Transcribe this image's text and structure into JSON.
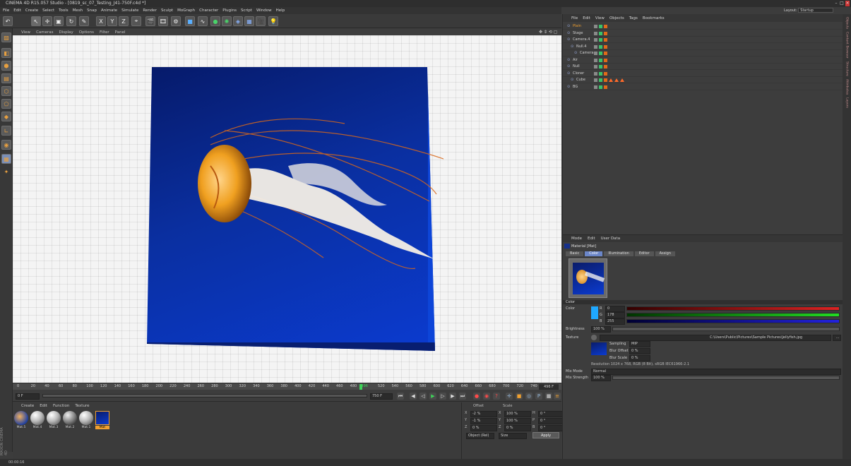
{
  "window": {
    "title": "CINEMA 4D R15.057 Studio - [0819_sc_07_Testing_J41-750F.c4d *]"
  },
  "menu": [
    "File",
    "Edit",
    "Create",
    "Select",
    "Tools",
    "Mesh",
    "Snap",
    "Animate",
    "Simulate",
    "Render",
    "Sculpt",
    "MoGraph",
    "Character",
    "Plugins",
    "Script",
    "Window",
    "Help"
  ],
  "layout": {
    "label": "Layout:",
    "value": "Startup"
  },
  "toolbar": {
    "x": "X",
    "y": "Y",
    "z": "Z"
  },
  "viewport": {
    "menu": [
      "View",
      "Cameras",
      "Display",
      "Options",
      "Filter",
      "Panel"
    ]
  },
  "timeline": {
    "ticks": [
      "0",
      "20",
      "40",
      "60",
      "80",
      "100",
      "120",
      "140",
      "160",
      "180",
      "200",
      "220",
      "240",
      "260",
      "280",
      "300",
      "320",
      "340",
      "360",
      "380",
      "400",
      "420",
      "440",
      "460",
      "480",
      "496",
      "520",
      "540",
      "560",
      "580",
      "600",
      "620",
      "640",
      "660",
      "680",
      "700",
      "720",
      "740"
    ],
    "end_frame": "496 F",
    "current_frame": 496,
    "frame_range": [
      0,
      750
    ]
  },
  "transport": {
    "start": "0 F",
    "end": "750 F"
  },
  "materials": {
    "menu": [
      "Create",
      "Edit",
      "Function",
      "Texture"
    ],
    "items": [
      {
        "name": "Mat.5",
        "selected": false
      },
      {
        "name": "Mat.4",
        "selected": false
      },
      {
        "name": "Mat.3",
        "selected": false
      },
      {
        "name": "Mat.2",
        "selected": false
      },
      {
        "name": "Mat.1",
        "selected": false
      },
      {
        "name": "Mat",
        "selected": true
      }
    ]
  },
  "maxon": "MAXON CINEMA 4D",
  "coords": {
    "headers": [
      "Position",
      "Offset",
      "Scale"
    ],
    "rows": [
      {
        "axis": "X",
        "pos": "-2 %",
        "scale_axis": "X",
        "scale": "100 %",
        "rot_axis": "H",
        "rot": "0 °"
      },
      {
        "axis": "Y",
        "pos": "-1 %",
        "scale_axis": "Y",
        "scale": "100 %",
        "rot_axis": "P",
        "rot": "0 °"
      },
      {
        "axis": "Z",
        "pos": "0 %",
        "scale_axis": "Z",
        "scale": "0 %",
        "rot_axis": "B",
        "rot": "0 °"
      }
    ],
    "mode": "Object (Rel)",
    "size_mode": "Size",
    "apply": "Apply"
  },
  "status": "00:00:16",
  "objects": {
    "menu": [
      "File",
      "Edit",
      "View",
      "Objects",
      "Tags",
      "Bookmarks"
    ],
    "items": [
      {
        "name": "Plain",
        "indent": 0,
        "highlight": true
      },
      {
        "name": "Stage",
        "indent": 0,
        "highlight": false
      },
      {
        "name": "Camera.4",
        "indent": 0,
        "highlight": false
      },
      {
        "name": "Null.4",
        "indent": 1,
        "highlight": false
      },
      {
        "name": "Camera",
        "indent": 2,
        "highlight": false
      },
      {
        "name": "Air",
        "indent": 0,
        "highlight": false
      },
      {
        "name": "Null",
        "indent": 0,
        "highlight": false
      },
      {
        "name": "Cloner",
        "indent": 0,
        "highlight": false
      },
      {
        "name": "Cube",
        "indent": 1,
        "highlight": false
      },
      {
        "name": "BG",
        "indent": 0,
        "highlight": false
      }
    ]
  },
  "attributes": {
    "menu": [
      "Mode",
      "Edit",
      "User Data"
    ],
    "title": "Material [Mat]",
    "tabs": [
      "Basic",
      "Color",
      "Illumination",
      "Editor",
      "Assign"
    ],
    "active_tab": "Color",
    "section": "Color",
    "color_label": "Color",
    "r_label": "R",
    "r": "0",
    "g_label": "G",
    "g": "178",
    "b_label": "B",
    "b": "255",
    "swatch": "#1fa8ff",
    "brightness_label": "Brightness",
    "brightness": "100 %",
    "texture_label": "Texture",
    "texture_path": "C:\\Users\\Public\\Pictures\\Sample Pictures\\Jellyfish.jpg",
    "sampling_label": "Sampling",
    "sampling": "MIP",
    "bluroffset_label": "Blur Offset",
    "bluroffset": "0 %",
    "blurscale_label": "Blur Scale",
    "blurscale": "0 %",
    "resolution": "Resolution 1024 x 768, RGB (8 Bit), sRGB IEC61966-2.1",
    "mixmode_label": "Mix Mode",
    "mixmode": "Normal",
    "mixstrength_label": "Mix Strength",
    "mixstrength": "100 %"
  },
  "rightstrip": [
    "Objects",
    "Content Browser",
    "Structure",
    "Attributes",
    "Layers"
  ]
}
